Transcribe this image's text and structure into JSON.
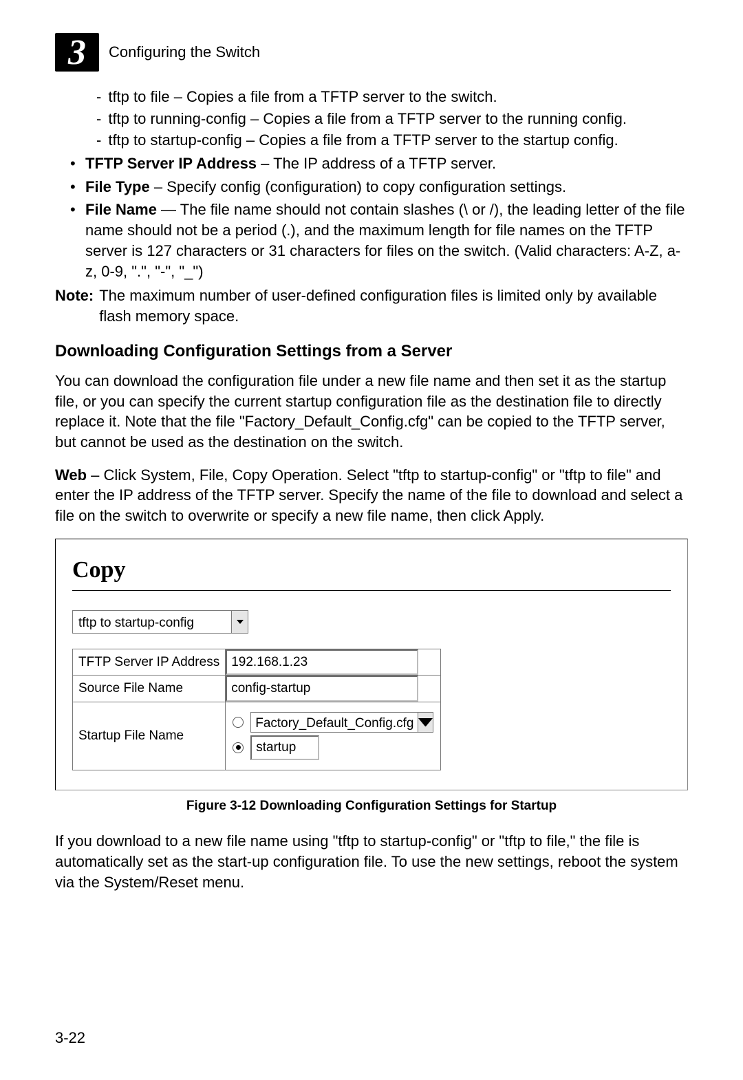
{
  "header": {
    "chapter_num": "3",
    "title": "Configuring the Switch"
  },
  "dash_items": [
    "tftp to file – Copies a file from a TFTP server to the switch.",
    "tftp to running-config – Copies a file from a TFTP server to the running config.",
    "tftp to startup-config – Copies a file from a TFTP server to the startup config."
  ],
  "bullets": {
    "tftp_ip": {
      "label": "TFTP Server IP Address",
      "desc": " – The IP address of a TFTP server."
    },
    "file_type": {
      "label": "File Type",
      "desc": " – Specify config (configuration) to copy configuration settings."
    },
    "file_name": {
      "label": "File Name",
      "desc": " — The file name should not contain slashes (\\ or /), the leading letter of the file name should not be a period (.), and the maximum length for file names on the TFTP server is 127 characters or 31 characters for files on the switch. (Valid characters: A-Z, a-z, 0-9, \".\", \"-\", \"_\")"
    }
  },
  "note": {
    "label": "Note:",
    "text": "The maximum number of user-defined configuration files is limited only by available flash memory space."
  },
  "section_heading": "Downloading Configuration Settings from a Server",
  "para1": "You can download the configuration file under a new file name and then set it as the startup file, or you can specify the current startup configuration file as the destination file to directly replace it. Note that the file \"Factory_Default_Config.cfg\" can be copied to the TFTP server, but cannot be used as the destination on the switch.",
  "para2_lead": "Web",
  "para2_rest": " – Click System, File, Copy Operation. Select \"tftp to startup-config\" or \"tftp to file\" and enter the IP address of the TFTP server. Specify the name of the file to download and select a file on the switch to overwrite or specify a new file name, then click Apply.",
  "figure": {
    "panel_title": "Copy",
    "operation_select": "tftp to startup-config",
    "rows": {
      "tftp_label": "TFTP Server IP Address",
      "tftp_value": "192.168.1.23",
      "src_label": "Source File Name",
      "src_value": "config-startup",
      "startup_label": "Startup File Name",
      "option_existing": "Factory_Default_Config.cfg",
      "option_new_value": "startup"
    },
    "caption": "Figure 3-12  Downloading Configuration Settings for Startup"
  },
  "para3": "If you download to a new file name using \"tftp to startup-config\" or \"tftp to file,\" the file is automatically set as the start-up configuration file. To use the new settings, reboot the system via the System/Reset menu.",
  "page_number": "3-22"
}
